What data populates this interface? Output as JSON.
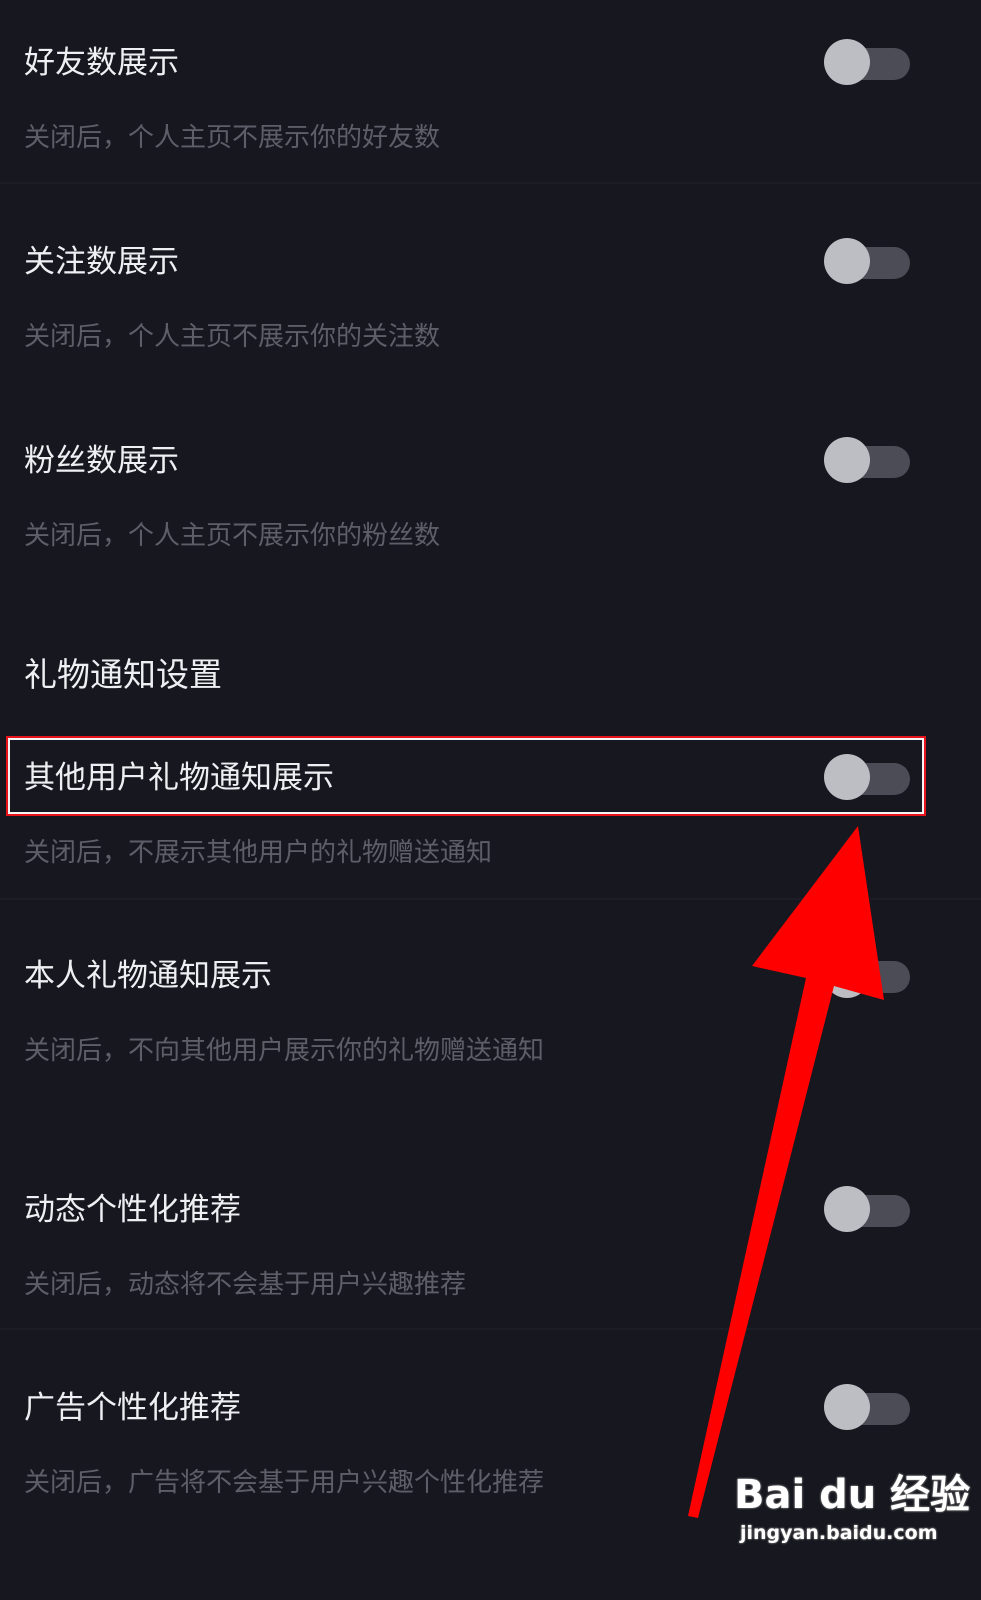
{
  "privacy_settings": {
    "friends_count": {
      "title": "好友数展示",
      "description": "关闭后，个人主页不展示你的好友数",
      "enabled": false
    },
    "following_count": {
      "title": "关注数展示",
      "description": "关闭后，个人主页不展示你的关注数",
      "enabled": false
    },
    "followers_count": {
      "title": "粉丝数展示",
      "description": "关闭后，个人主页不展示你的粉丝数",
      "enabled": false
    }
  },
  "gift_notification": {
    "section_title": "礼物通知设置",
    "others_gift": {
      "title": "其他用户礼物通知展示",
      "description": "关闭后，不展示其他用户的礼物赠送通知",
      "enabled": false
    },
    "own_gift": {
      "title": "本人礼物通知展示",
      "description": "关闭后，不向其他用户展示你的礼物赠送通知",
      "enabled": false
    }
  },
  "personalization": {
    "feed": {
      "title": "动态个性化推荐",
      "description": "关闭后，动态将不会基于用户兴趣推荐",
      "enabled": false
    },
    "ads": {
      "title": "广告个性化推荐",
      "description": "关闭后，广告将不会基于用户兴趣个性化推荐",
      "enabled": false
    }
  },
  "colors": {
    "background": "#16171f",
    "toggle_track": "#4b4c55",
    "toggle_knob": "#bdbec3",
    "highlight": "#e8141c",
    "arrow": "#ff0000"
  },
  "watermark": {
    "logo": "Bai du 经验",
    "url": "jingyan.baidu.com"
  }
}
